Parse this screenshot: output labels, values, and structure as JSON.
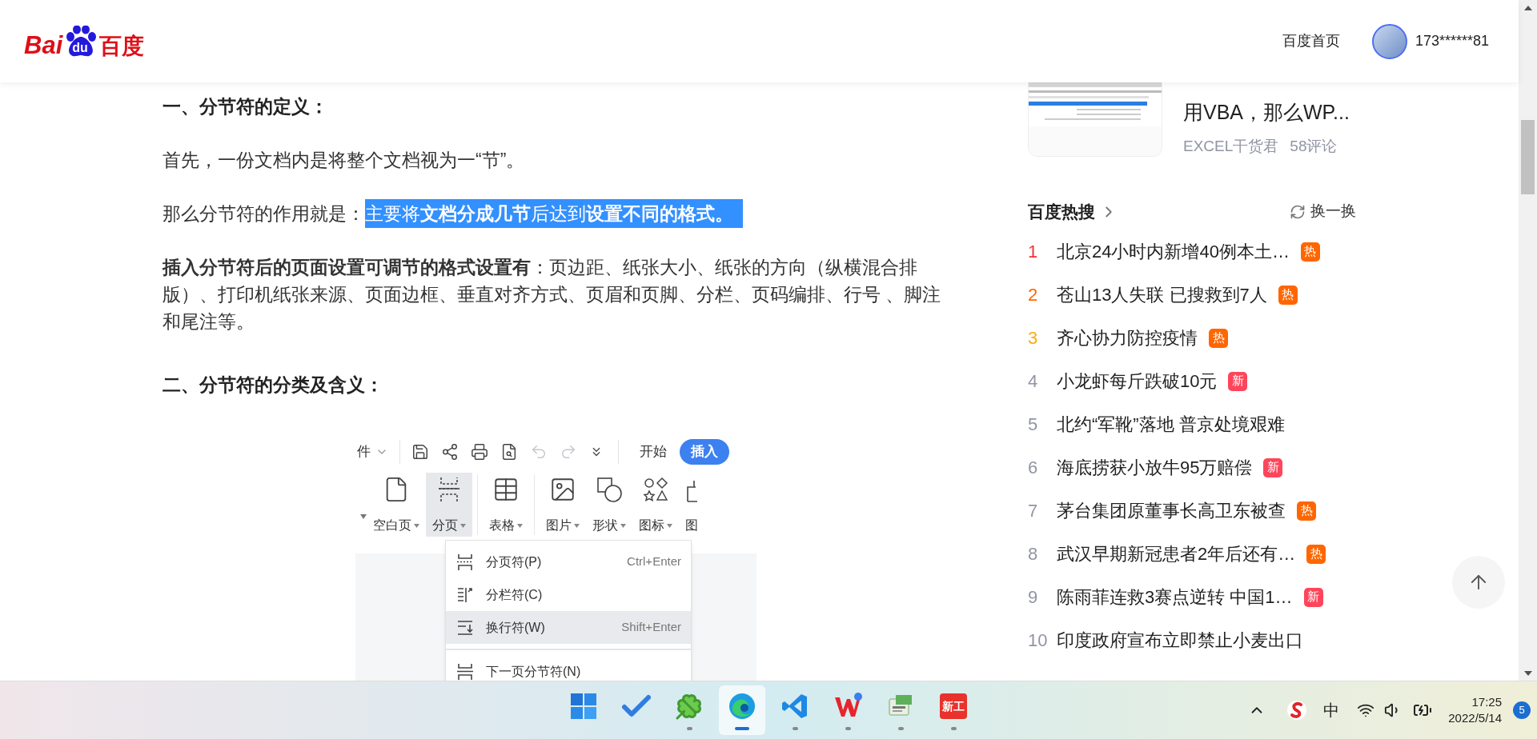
{
  "header": {
    "logo": [
      "Bai",
      "du",
      "百度"
    ],
    "home_link": "百度首页",
    "user": "173******81"
  },
  "article": {
    "blocks": [
      {
        "kind": "heading",
        "text": "一、分节符的定义："
      },
      {
        "kind": "paragraph",
        "text": "首先，一份文档内是将整个文档视为一“节”。"
      },
      {
        "kind": "paragraph",
        "text": "那么分节符的作用就是：",
        "highlight": "主要将**文档分成几节**后达到**设置不同的格式。**",
        "highlighted": true
      },
      {
        "kind": "paragraph",
        "text": "**插入分节符后的页面设置可调节的格式设置有**：页边距、纸张大小、纸张的方向（纵横混合排版）、打印机纸张来源、页面边框、垂直对齐方式、页眉和页脚、分栏、页码编排、行号 、脚注和尾注等。"
      },
      {
        "kind": "heading",
        "text": "二、分节符的分类及含义："
      }
    ],
    "screenshot": {
      "file_menu": "件",
      "tools": [
        {
          "kind": "save",
          "disabled": false
        },
        {
          "kind": "share",
          "disabled": false
        },
        {
          "kind": "print",
          "disabled": false
        },
        {
          "kind": "preview",
          "disabled": false
        },
        {
          "kind": "undo",
          "disabled": true
        },
        {
          "kind": "redo",
          "disabled": true
        },
        {
          "kind": "more",
          "disabled": false
        }
      ],
      "tabs": [
        {
          "label": "开始",
          "selected": false
        },
        {
          "label": "插入",
          "selected": true
        }
      ],
      "ribbon": [
        {
          "kind": "blank-page",
          "label": "空白页",
          "selected": false,
          "separator_before": false
        },
        {
          "kind": "page-break",
          "label": "分页",
          "selected": true,
          "separator_before": false
        },
        {
          "kind": "table",
          "label": "表格",
          "selected": false,
          "separator_before": true
        },
        {
          "kind": "picture",
          "label": "图片",
          "selected": false,
          "separator_before": true
        },
        {
          "kind": "shape",
          "label": "形状",
          "selected": false,
          "separator_before": false
        },
        {
          "kind": "icons",
          "label": "图标",
          "selected": false,
          "separator_before": false
        },
        {
          "kind": "cut",
          "label": "图",
          "selected": false,
          "separator_before": false
        }
      ],
      "menu": [
        {
          "kind": "page-break",
          "label": "分页符(P)",
          "shortcut": "Ctrl+Enter",
          "selected": false,
          "separator_before": false
        },
        {
          "kind": "column-break",
          "label": "分栏符(C)",
          "selected": false,
          "separator_before": false
        },
        {
          "kind": "line-break",
          "label": "换行符(W)",
          "shortcut": "Shift+Enter",
          "selected": true,
          "separator_before": false
        },
        {
          "kind": "section-break",
          "label": "下一页分节符(N)",
          "selected": false,
          "separator_before": true
        }
      ]
    }
  },
  "sidebar": {
    "card": {
      "title": "用VBA，那么WP...",
      "author": "EXCEL干货君",
      "comments": "58评论"
    },
    "hot_search": {
      "title": "百度热搜",
      "refresh": "换一换",
      "items": [
        {
          "rank": "1",
          "color": "#f73131",
          "text": "北京24小时内新增40例本土…",
          "tag": {
            "text": "热",
            "kind": "hot"
          }
        },
        {
          "rank": "2",
          "color": "#ff6600",
          "text": "苍山13人失联 已搜救到7人",
          "tag": {
            "text": "热",
            "kind": "hot"
          }
        },
        {
          "rank": "3",
          "color": "#faa90e",
          "text": "齐心协力防控疫情",
          "tag": {
            "text": "热",
            "kind": "hot"
          }
        },
        {
          "rank": "4",
          "color": "#9195a3",
          "text": "小龙虾每斤跌破10元",
          "tag": {
            "text": "新",
            "kind": "new"
          }
        },
        {
          "rank": "5",
          "color": "#9195a3",
          "text": "北约“军靴”落地 普京处境艰难"
        },
        {
          "rank": "6",
          "color": "#9195a3",
          "text": "海底捞获小放牛95万赔偿",
          "tag": {
            "text": "新",
            "kind": "new"
          }
        },
        {
          "rank": "7",
          "color": "#9195a3",
          "text": "茅台集团原董事长高卫东被查",
          "tag": {
            "text": "热",
            "kind": "hot"
          }
        },
        {
          "rank": "8",
          "color": "#9195a3",
          "text": "武汉早期新冠患者2年后还有…",
          "tag": {
            "text": "热",
            "kind": "hot"
          }
        },
        {
          "rank": "9",
          "color": "#9195a3",
          "text": "陈雨菲连救3赛点逆转 中国1…",
          "tag": {
            "text": "新",
            "kind": "new"
          }
        },
        {
          "rank": "10",
          "color": "#9195a3",
          "text": "印度政府宣布立即禁止小麦出口"
        }
      ]
    }
  },
  "taskbar": {
    "apps": [
      {
        "kind": "start",
        "running": false,
        "selected": false
      },
      {
        "kind": "todo",
        "running": false,
        "selected": false
      },
      {
        "kind": "clover",
        "running": true,
        "selected": false
      },
      {
        "kind": "edge",
        "running": true,
        "selected": true
      },
      {
        "kind": "vscode",
        "running": true,
        "selected": false
      },
      {
        "kind": "wps",
        "running": true,
        "selected": false
      },
      {
        "kind": "spacedesk",
        "running": true,
        "selected": false
      },
      {
        "kind": "xingong",
        "label": "新工",
        "running": true,
        "selected": false
      }
    ],
    "ime": "中",
    "time": "17:25",
    "date": "2022/5/14",
    "notifications": "5"
  }
}
